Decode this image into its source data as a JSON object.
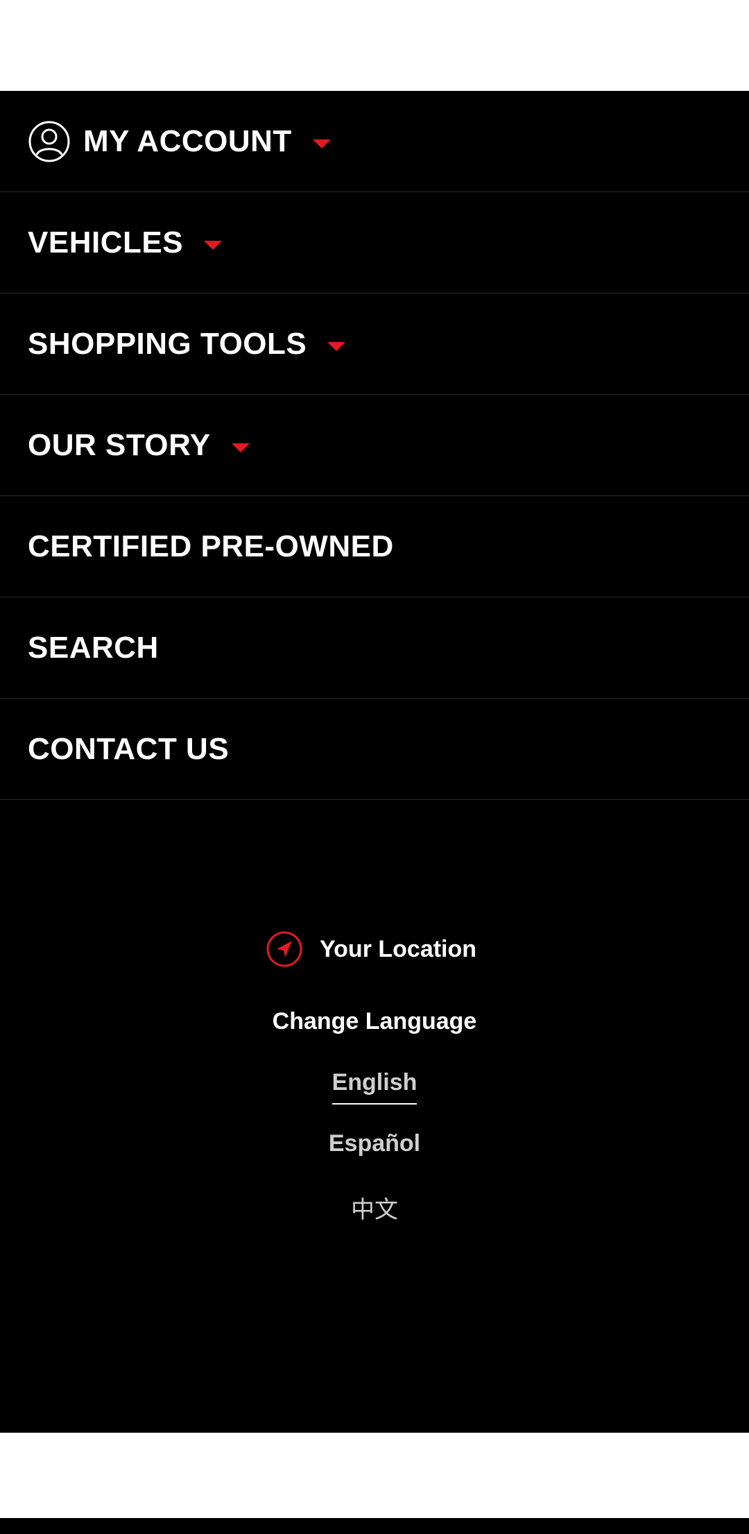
{
  "menu": {
    "items": [
      {
        "label": "MY ACCOUNT",
        "has_dropdown": true,
        "icon": "user-circle-icon"
      },
      {
        "label": "VEHICLES",
        "has_dropdown": true
      },
      {
        "label": "SHOPPING TOOLS",
        "has_dropdown": true
      },
      {
        "label": "OUR STORY",
        "has_dropdown": true
      },
      {
        "label": "CERTIFIED PRE-OWNED",
        "has_dropdown": false
      },
      {
        "label": "SEARCH",
        "has_dropdown": false
      },
      {
        "label": "CONTACT US",
        "has_dropdown": false
      }
    ]
  },
  "location": {
    "label": "Your Location",
    "icon": "location-arrow-icon"
  },
  "language": {
    "title": "Change Language",
    "options": [
      "English",
      "Español",
      "中文"
    ],
    "selected": "English"
  },
  "colors": {
    "background": "#000000",
    "accent": "#e21a22",
    "text": "#ffffff"
  }
}
